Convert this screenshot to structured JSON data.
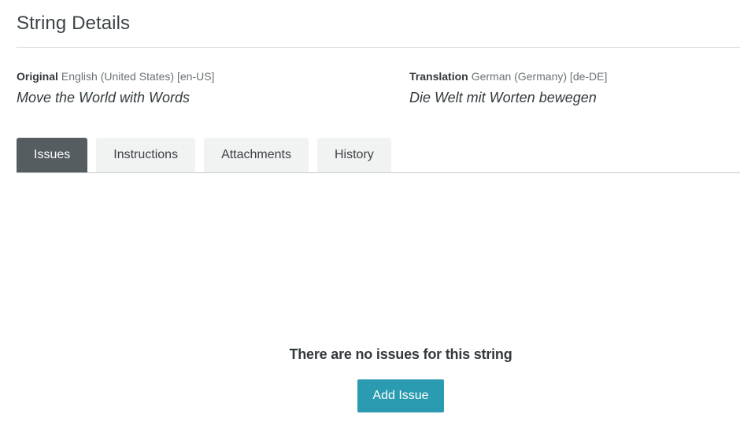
{
  "page": {
    "title": "String Details"
  },
  "original": {
    "label": "Original",
    "locale": "English (United States) [en-US]",
    "text": "Move the World with Words"
  },
  "translation": {
    "label": "Translation",
    "locale": "German (Germany) [de-DE]",
    "text": "Die Welt mit Worten bewegen"
  },
  "tabs": [
    {
      "label": "Issues",
      "active": true
    },
    {
      "label": "Instructions",
      "active": false
    },
    {
      "label": "Attachments",
      "active": false
    },
    {
      "label": "History",
      "active": false
    }
  ],
  "issues": {
    "empty_message": "There are no issues for this string",
    "add_button_label": "Add Issue"
  },
  "colors": {
    "active_tab": "#555d60",
    "inactive_tab": "#f1f2f2",
    "primary_button": "#2a9bb0"
  }
}
